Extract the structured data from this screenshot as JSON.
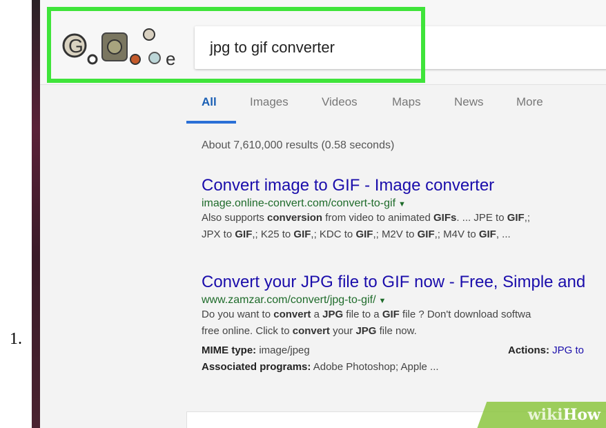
{
  "step_number": "1.",
  "search": {
    "query": "jpg to gif converter"
  },
  "tabs": [
    "All",
    "Images",
    "Videos",
    "Maps",
    "News",
    "More"
  ],
  "results_count": "About 7,610,000 results (0.58 seconds)",
  "results": [
    {
      "title": "Convert image to GIF - Image converter",
      "url": "image.online-convert.com/convert-to-gif",
      "snippet_line1": [
        "Also supports ",
        "conversion",
        " from video to animated ",
        "GIFs",
        ". ... JPE to ",
        "GIF",
        ",; "
      ],
      "snippet_line2": [
        "JPX to ",
        "GIF",
        ",; K25 to ",
        "GIF",
        ",; KDC to ",
        "GIF",
        ",; M2V to ",
        "GIF",
        ",; M4V to ",
        "GIF",
        ", ..."
      ]
    },
    {
      "title": "Convert your JPG file to GIF now - Free, Simple and",
      "url": "www.zamzar.com/convert/jpg-to-gif/",
      "snippet_line1": [
        "Do you want to ",
        "convert",
        " a ",
        "JPG",
        " file to a ",
        "GIF",
        " file ? Don't download softwa"
      ],
      "snippet_line2": [
        "free online. Click to ",
        "convert",
        " your ",
        "JPG",
        " file now."
      ],
      "mime_label": "MIME type:",
      "mime_value": " image/jpeg",
      "actions_label": "Actions:",
      "actions_value": " JPG to",
      "assoc_label": "Associated programs:",
      "assoc_value": " Adobe Photoshop; Apple ..."
    }
  ],
  "watermark": {
    "wiki": "wiki",
    "how": "How"
  }
}
